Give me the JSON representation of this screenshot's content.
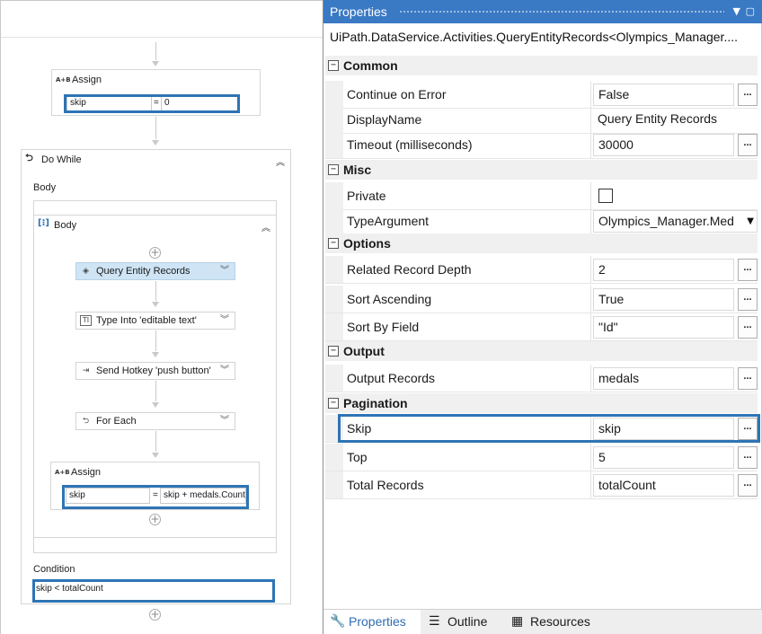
{
  "designer": {
    "assign_top": {
      "title": "Assign",
      "to": "skip",
      "eq": "=",
      "value": "0"
    },
    "do_while": {
      "title": "Do While",
      "body_label": "Body",
      "condition_label": "Condition",
      "condition_value": "skip < totalCount"
    },
    "body_sequence": {
      "title": "Body"
    },
    "activities": [
      {
        "label": "Query Entity Records",
        "icon": "query-entity-icon",
        "selected": true
      },
      {
        "label": "Type Into 'editable text'",
        "icon": "type-into-icon",
        "selected": false
      },
      {
        "label": "Send Hotkey 'push button'",
        "icon": "send-hotkey-icon",
        "selected": false
      },
      {
        "label": "For Each",
        "icon": "for-each-icon",
        "selected": false
      }
    ],
    "assign_inner": {
      "title": "Assign",
      "to": "skip",
      "eq": "=",
      "value": "skip + medals.Count"
    }
  },
  "properties": {
    "title": "Properties",
    "activity_type": "UiPath.DataService.Activities.QueryEntityRecords<Olympics_Manager....",
    "categories": [
      {
        "name": "Common",
        "rows": [
          {
            "name": "Continue on Error",
            "value": "False",
            "kind": "text",
            "ellipsis": true
          },
          {
            "name": "DisplayName",
            "value": "Query Entity Records",
            "kind": "plain",
            "ellipsis": false
          },
          {
            "name": "Timeout (milliseconds)",
            "value": "30000",
            "kind": "text",
            "ellipsis": true
          }
        ]
      },
      {
        "name": "Misc",
        "rows": [
          {
            "name": "Private",
            "value": "",
            "kind": "checkbox",
            "ellipsis": false
          },
          {
            "name": "TypeArgument",
            "value": "Olympics_Manager.Med",
            "kind": "combo",
            "ellipsis": false
          }
        ]
      },
      {
        "name": "Options",
        "rows": [
          {
            "name": "Related Record Depth",
            "value": "2",
            "kind": "text",
            "ellipsis": true
          },
          {
            "name": "Sort Ascending",
            "value": "True",
            "kind": "text",
            "ellipsis": true
          },
          {
            "name": "Sort By Field",
            "value": "\"Id\"",
            "kind": "text",
            "ellipsis": true
          }
        ]
      },
      {
        "name": "Output",
        "rows": [
          {
            "name": "Output Records",
            "value": "medals",
            "kind": "text",
            "ellipsis": true
          }
        ]
      },
      {
        "name": "Pagination",
        "rows": [
          {
            "name": "Skip",
            "value": "skip",
            "kind": "text",
            "ellipsis": true,
            "highlighted": true
          },
          {
            "name": "Top",
            "value": "5",
            "kind": "text",
            "ellipsis": true
          },
          {
            "name": "Total Records",
            "value": "totalCount",
            "kind": "text",
            "ellipsis": true
          }
        ]
      }
    ],
    "ellipsis_label": "...",
    "expander_label": "−",
    "dropdown_glyph": "▼",
    "bottom_tabs": [
      {
        "label": "Properties",
        "icon": "wrench-icon",
        "active": true
      },
      {
        "label": "Outline",
        "icon": "outline-icon",
        "active": false
      },
      {
        "label": "Resources",
        "icon": "resources-icon",
        "active": false
      }
    ]
  },
  "colors": {
    "accent": "#3a79c4",
    "highlight": "#2e74b5",
    "selected_activity": "#cfe4f4"
  }
}
